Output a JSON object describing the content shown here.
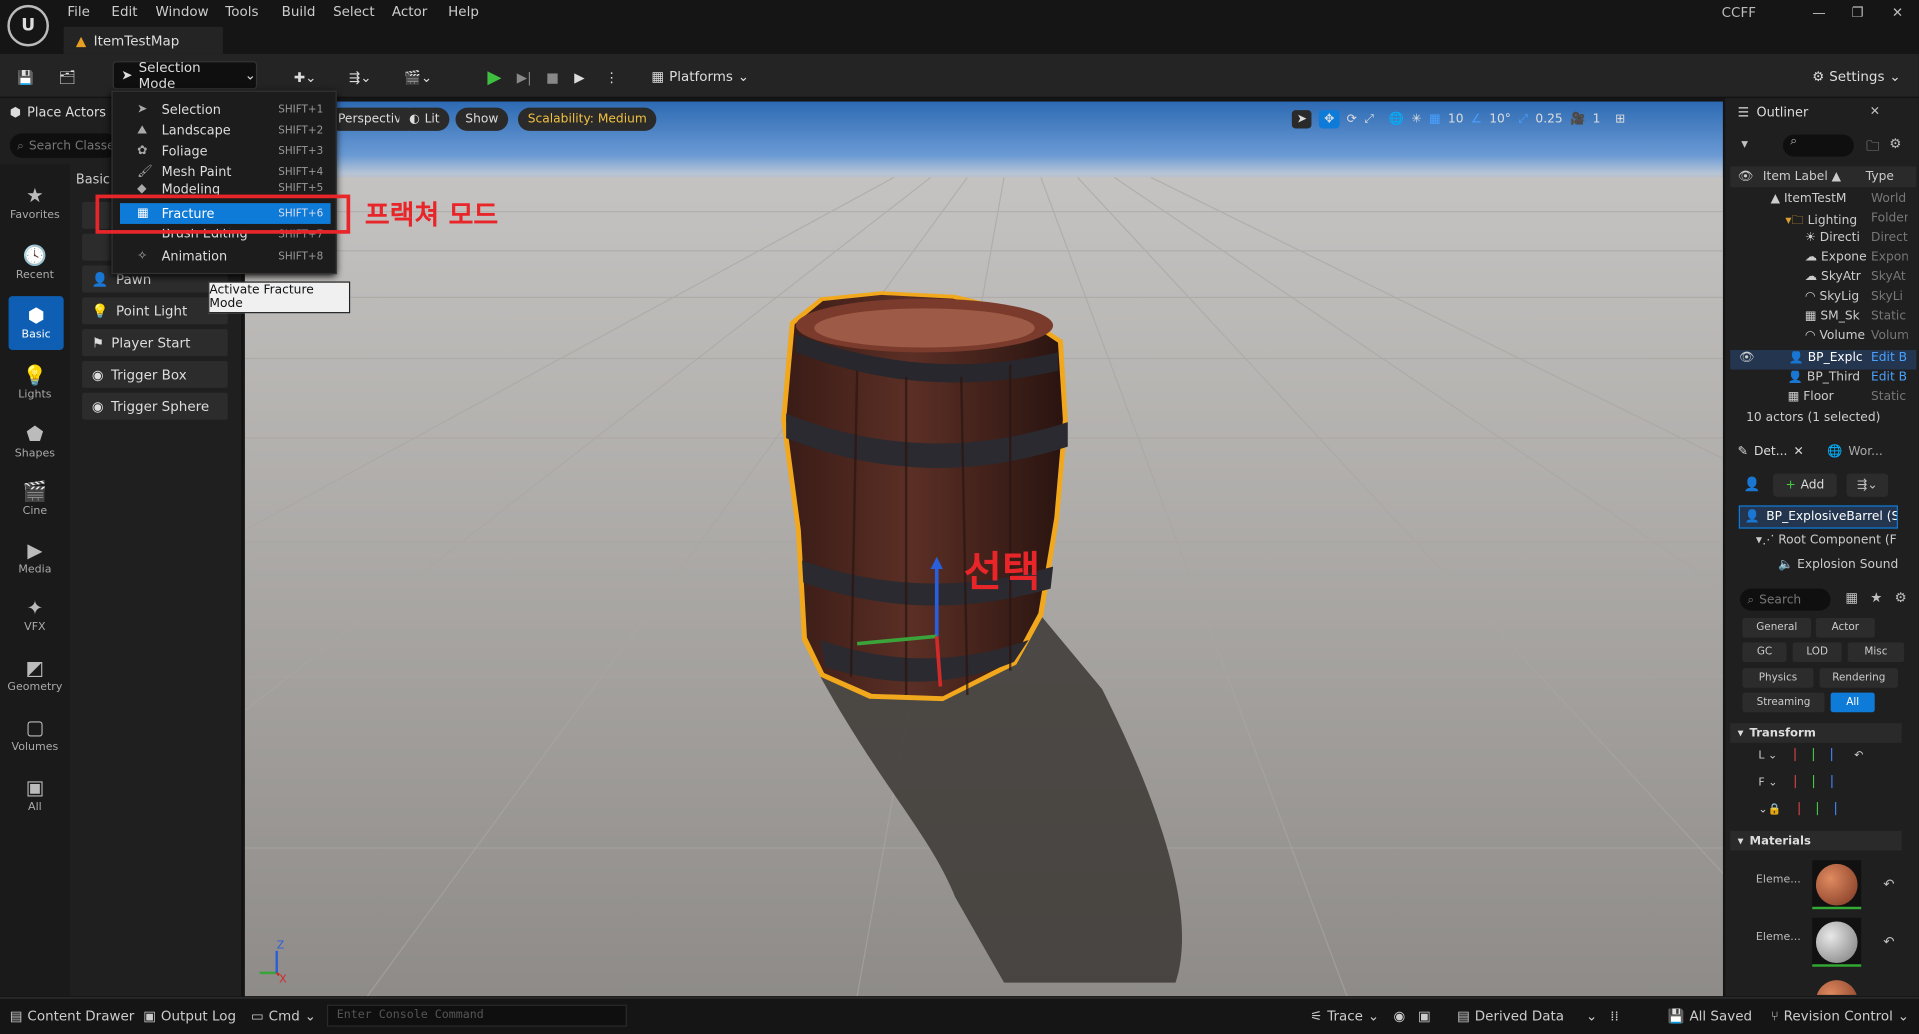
{
  "menu": {
    "items": [
      "File",
      "Edit",
      "Window",
      "Tools",
      "Build",
      "Select",
      "Actor",
      "Help"
    ]
  },
  "tab": {
    "title": "ItemTestMap"
  },
  "window": {
    "project": "CCFF",
    "minimize": "—",
    "restore": "❐",
    "close": "✕"
  },
  "toolbar": {
    "selection_mode": "Selection Mode",
    "platforms": "Platforms",
    "settings": "Settings"
  },
  "place_actors": {
    "title": "Place Actors",
    "search_placeholder": "Search Classes",
    "section": "Basic",
    "items": [
      "Pawn",
      "Point Light",
      "Player Start",
      "Trigger Box",
      "Trigger Sphere"
    ]
  },
  "categories": [
    "Favorites",
    "Recent",
    "Basic",
    "Lights",
    "Shapes",
    "Cine",
    "Media",
    "VFX",
    "Geometry",
    "Volumes",
    "All"
  ],
  "mode_menu": {
    "items": [
      {
        "label": "Selection",
        "shortcut": "SHIFT+1"
      },
      {
        "label": "Landscape",
        "shortcut": "SHIFT+2"
      },
      {
        "label": "Foliage",
        "shortcut": "SHIFT+3"
      },
      {
        "label": "Mesh Paint",
        "shortcut": "SHIFT+4"
      },
      {
        "label": "Modeling",
        "shortcut": "SHIFT+5"
      },
      {
        "label": "Fracture",
        "shortcut": "SHIFT+6"
      },
      {
        "label": "Brush Editing",
        "shortcut": "SHIFT+7"
      },
      {
        "label": "Animation",
        "shortcut": "SHIFT+8"
      }
    ],
    "tooltip": "Activate Fracture Mode"
  },
  "annotations": {
    "fracture_mode": "프랙쳐 모드",
    "selected": "선택"
  },
  "viewport": {
    "perspective": "Perspective",
    "lit": "Lit",
    "show": "Show",
    "scalability": "Scalability: Medium",
    "grid": "10",
    "angle": "10°",
    "scale": "0.25",
    "camera": "1"
  },
  "outliner": {
    "title": "Outliner",
    "col_label": "Item Label ▲",
    "col_type": "Type",
    "rows": [
      {
        "label": "ItemTestM",
        "type": "World"
      },
      {
        "label": "Lighting",
        "type": "Folder"
      },
      {
        "label": "Directi",
        "type": "Direct"
      },
      {
        "label": "Expone",
        "type": "Expon"
      },
      {
        "label": "SkyAtr",
        "type": "SkyAt"
      },
      {
        "label": "SkyLig",
        "type": "SkyLi"
      },
      {
        "label": "SM_Sk",
        "type": "Static"
      },
      {
        "label": "Volume",
        "type": "Volum"
      },
      {
        "label": "BP_Explc",
        "type": "Edit B"
      },
      {
        "label": "BP_Third",
        "type": "Edit B"
      },
      {
        "label": "Floor",
        "type": "Static"
      }
    ],
    "count": "10 actors (1 selected)"
  },
  "details": {
    "tab1": "Det...",
    "tab2": "Wor...",
    "add": "Add",
    "actor": "BP_ExplosiveBarrel (S",
    "components": [
      "Root Component (F",
      "Explosion Sound"
    ],
    "search": "Search",
    "filters": [
      "General",
      "Actor",
      "GC",
      "LOD",
      "Misc",
      "Physics",
      "Rendering",
      "Streaming",
      "All"
    ],
    "transform": "Transform",
    "materials": "Materials",
    "element": "Eleme..."
  },
  "status": {
    "content_drawer": "Content Drawer",
    "output_log": "Output Log",
    "cmd": "Cmd",
    "console_placeholder": "Enter Console Command",
    "trace": "Trace",
    "derived_data": "Derived Data",
    "all_saved": "All Saved",
    "revision_control": "Revision Control"
  },
  "colors": {
    "accent": "#0e7bd8",
    "annotation": "#e8262a",
    "selection_outline": "#f2a81d"
  }
}
